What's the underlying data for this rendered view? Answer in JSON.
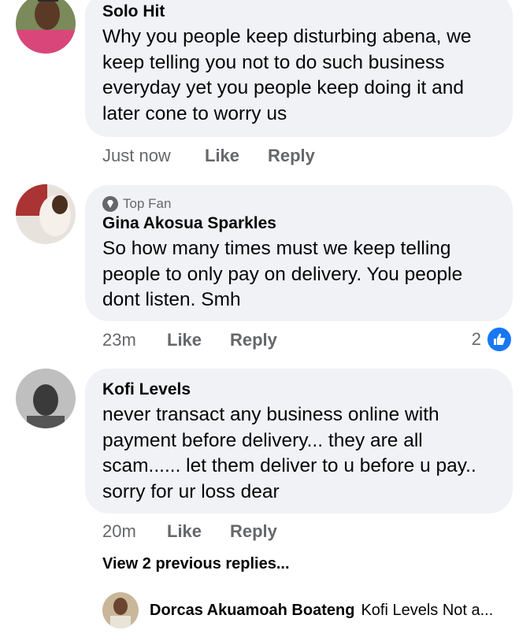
{
  "comments": [
    {
      "author": "Solo Hit",
      "text": "Why you people keep disturbing abena, we keep telling you not to do such business everyday yet you people keep doing it and later cone to worry us",
      "lines": [
        "Why you people keep disturbing abena, we",
        "keep telling you not to do such business",
        "everyday yet you people keep doing it and",
        "later cone to worry us"
      ],
      "time": "Just now",
      "like_label": "Like",
      "reply_label": "Reply"
    },
    {
      "badge": "Top Fan",
      "author": "Gina Akosua Sparkles",
      "lines": [
        "So how many times must we keep telling",
        "people to only pay on delivery. You people",
        "dont listen. Smh"
      ],
      "time": "23m",
      "like_label": "Like",
      "reply_label": "Reply",
      "reaction_count": "2"
    },
    {
      "author": "Kofi Levels",
      "lines": [
        "never transact any business online with",
        "payment before delivery... they are all",
        "scam...... let them deliver to u before u pay..",
        "sorry for ur loss dear"
      ],
      "time": "20m",
      "like_label": "Like",
      "reply_label": "Reply"
    }
  ],
  "view_replies": "View 2 previous replies...",
  "latest_reply": {
    "author": "Dorcas Akuamoah Boateng",
    "snippet": "Kofi Levels Not a..."
  },
  "colors": {
    "bubble": "#f0f2f5",
    "meta": "#65676b",
    "like_blue": "#1877f2"
  },
  "icons": [
    "top-fan-diamond-icon",
    "thumbs-up-icon"
  ]
}
